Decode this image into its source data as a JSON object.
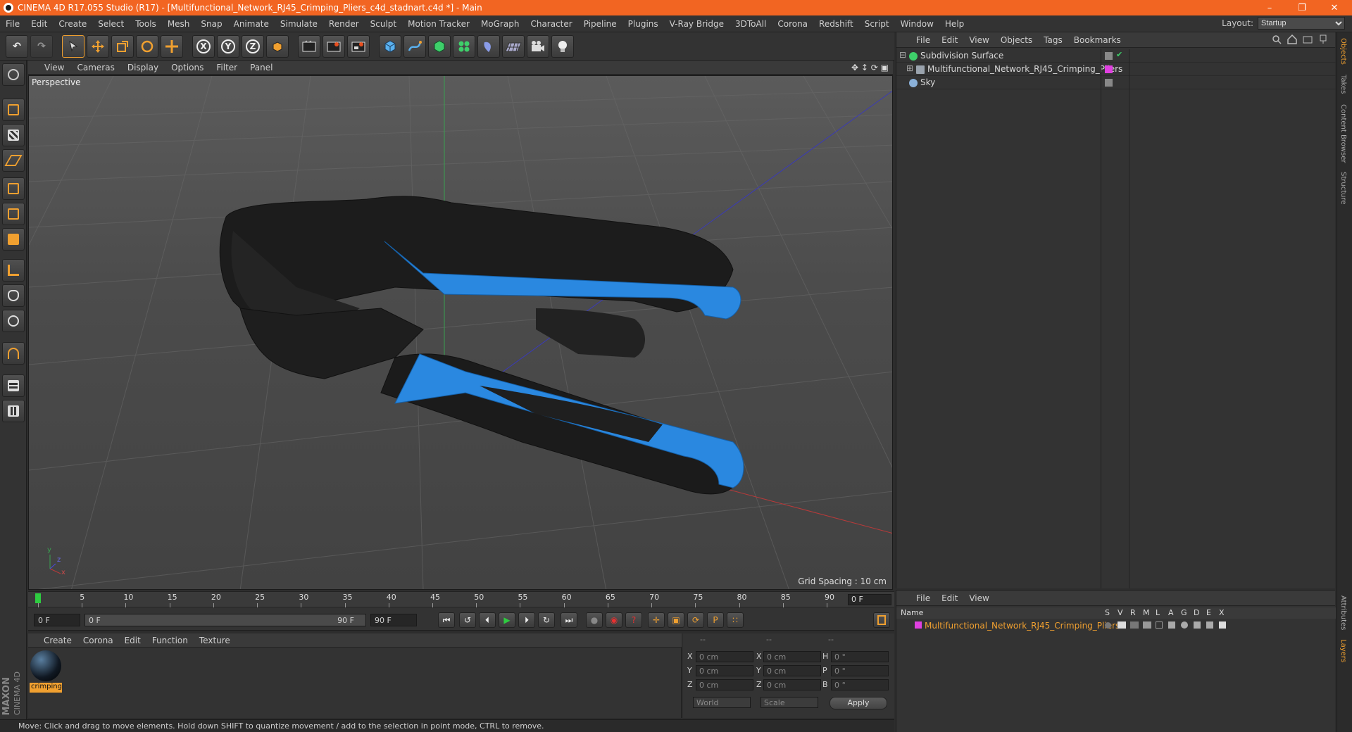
{
  "window": {
    "title": "CINEMA 4D R17.055 Studio (R17) - [Multifunctional_Network_RJ45_Crimping_Pliers_c4d_stadnart.c4d *] - Main",
    "min_glyph": "–",
    "max_glyph": "❐",
    "close_glyph": "✕"
  },
  "menubar": {
    "items": [
      "File",
      "Edit",
      "Create",
      "Select",
      "Tools",
      "Mesh",
      "Snap",
      "Animate",
      "Simulate",
      "Render",
      "Sculpt",
      "Motion Tracker",
      "MoGraph",
      "Character",
      "Pipeline",
      "Plugins",
      "V-Ray Bridge",
      "3DToAll",
      "Corona",
      "Redshift",
      "Script",
      "Window",
      "Help"
    ],
    "layout_label": "Layout:",
    "layout_value": "Startup"
  },
  "toolbar": {
    "undo_glyph": "↶",
    "redo_glyph": "↷",
    "x_label": "X",
    "y_label": "Y",
    "z_label": "Z"
  },
  "viewport": {
    "menu": [
      "View",
      "Cameras",
      "Display",
      "Options",
      "Filter",
      "Panel"
    ],
    "nav_glyphs": "✥ ↕ ⟳ ▣",
    "camera": "Perspective",
    "grid_spacing": "Grid Spacing : 10 cm",
    "axis_y": "y",
    "axis_z": "z",
    "axis_x": "x"
  },
  "timeline": {
    "ticks": [
      "0",
      "5",
      "10",
      "15",
      "20",
      "25",
      "30",
      "35",
      "40",
      "45",
      "50",
      "55",
      "60",
      "65",
      "70",
      "75",
      "80",
      "85",
      "90"
    ],
    "current_frame": "0 F",
    "start_field": "0 F",
    "range_start": "0 F",
    "range_end": "90 F",
    "end_field": "90 F"
  },
  "transport": {
    "glyphs": [
      "⏮",
      "↺",
      "⏴",
      "▶",
      "⏵",
      "↻",
      "⏭"
    ],
    "record_glyphs": [
      "●",
      "◉",
      "?"
    ],
    "key_glyphs": [
      "✛",
      "▣",
      "⟳",
      "P",
      "∷"
    ]
  },
  "materials": {
    "menu": [
      "Create",
      "Corona",
      "Edit",
      "Function",
      "Texture"
    ],
    "items": [
      {
        "name": "crimping"
      }
    ]
  },
  "coords": {
    "headers": [
      "--",
      "--",
      "--"
    ],
    "rows": [
      {
        "a": "X",
        "av": "0 cm",
        "b": "X",
        "bv": "0 cm",
        "c": "H",
        "cv": "0 °"
      },
      {
        "a": "Y",
        "av": "0 cm",
        "b": "Y",
        "bv": "0 cm",
        "c": "P",
        "cv": "0 °"
      },
      {
        "a": "Z",
        "av": "0 cm",
        "b": "Z",
        "bv": "0 cm",
        "c": "B",
        "cv": "0 °"
      }
    ],
    "mode": "World",
    "scale": "Scale",
    "apply": "Apply"
  },
  "status": "Move: Click and drag to move elements. Hold down SHIFT to quantize movement / add to the selection in point mode, CTRL to remove.",
  "objects": {
    "menu": [
      "File",
      "Edit",
      "View",
      "Objects",
      "Tags",
      "Bookmarks"
    ],
    "rows": [
      {
        "name": "Subdivision Surface",
        "icon_color": "#3ecf6a",
        "tag_color": ""
      },
      {
        "name": "Multifunctional_Network_RJ45_Crimping_Pliers",
        "icon_color": "#9aa3ad",
        "tag_color": "#e040e0"
      },
      {
        "name": "Sky",
        "icon_color": "#8ab0d8",
        "tag_color": ""
      }
    ],
    "check": "✔",
    "expand": "⊞",
    "collapse": "⊟"
  },
  "layers": {
    "menu": [
      "File",
      "Edit",
      "View"
    ],
    "columns": [
      "Name",
      "S",
      "V",
      "R",
      "M",
      "L",
      "A",
      "G",
      "D",
      "E",
      "X"
    ],
    "rows": [
      {
        "name": "Multifunctional_Network_RJ45_Crimping_Pliers",
        "color": "#e040e0"
      }
    ]
  },
  "sidetabs": [
    "Objects",
    "Takes",
    "Content Browser",
    "Structure",
    "Attributes",
    "Layers"
  ],
  "branding": {
    "maxon": "MAXON",
    "c4d": "CINEMA 4D"
  },
  "colors": {
    "accent": "#f26522",
    "blue_grip": "#2a88e0",
    "selection": "#f0a030"
  }
}
